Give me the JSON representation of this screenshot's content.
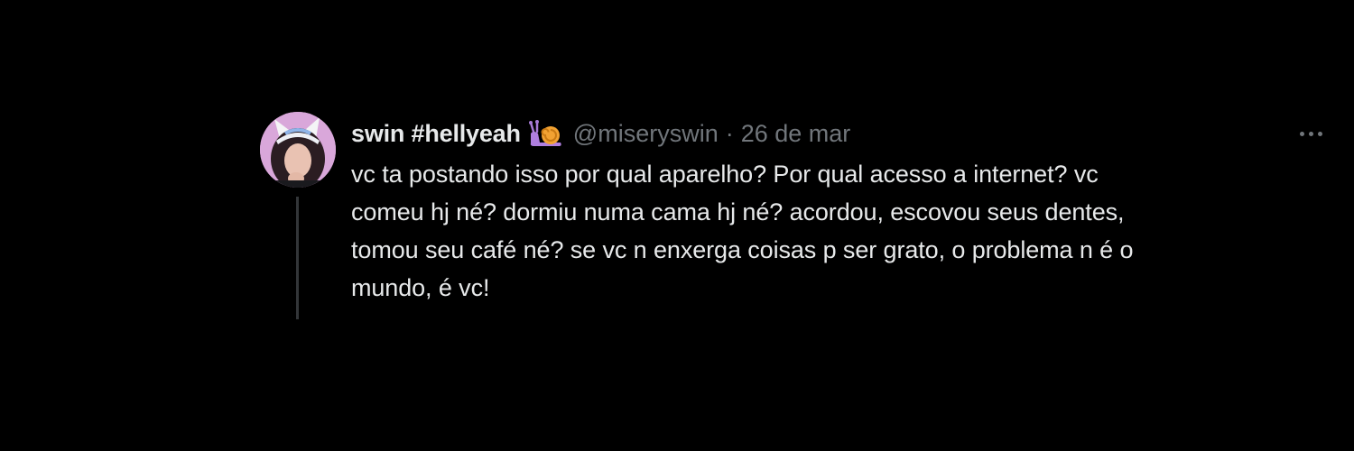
{
  "tweet": {
    "display_name": "swin #hellyeah",
    "badge_icon": "snail-icon",
    "handle": "@miseryswin",
    "separator": "·",
    "date": "26 de mar",
    "text": "vc ta postando isso por qual aparelho? Por qual acesso a internet? vc\ncomeu hj né? dormiu numa cama hj né? acordou, escovou seus dentes,\ntomou seu café né? se vc n enxerga coisas p ser grato, o problema n é o\nmundo, é vc!",
    "more_icon": "more-horizontal-icon"
  },
  "colors": {
    "background": "#000000",
    "primary_text": "#e7e9ea",
    "secondary_text": "#71767b",
    "thread_line": "#333639",
    "avatar_bg": "#d7a6d8"
  }
}
